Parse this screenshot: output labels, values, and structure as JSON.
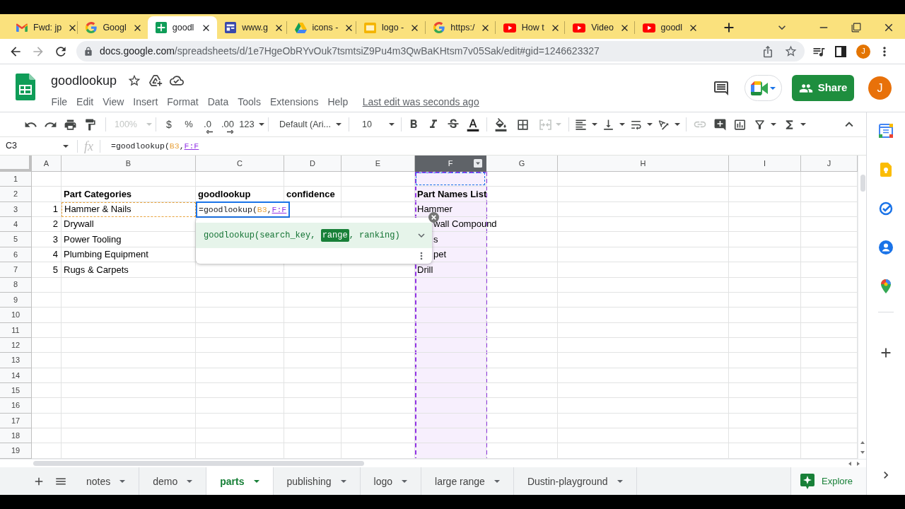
{
  "browser": {
    "tabs": [
      {
        "title": "Fwd: jp",
        "kind": "mail",
        "selected": false
      },
      {
        "title": "Googl",
        "kind": "g-logo",
        "selected": false
      },
      {
        "title": "goodl",
        "kind": "sheet",
        "selected": true
      },
      {
        "title": "www.g",
        "kind": "site",
        "selected": false
      },
      {
        "title": "icons -",
        "kind": "drive",
        "selected": false
      },
      {
        "title": "logo -",
        "kind": "slide",
        "selected": false
      },
      {
        "title": "https:/",
        "kind": "g-logo",
        "selected": false
      },
      {
        "title": "How t",
        "kind": "video",
        "selected": false
      },
      {
        "title": "Video",
        "kind": "video",
        "selected": false
      },
      {
        "title": "goodl",
        "kind": "video",
        "selected": false
      }
    ],
    "url": {
      "host": "docs.google.com",
      "path": "/spreadsheets/d/1e7HgeObRYvOuk7tsmtsiZ9Pu4m3QwBaKHtsm7v05Sak/edit#gid=1246623327"
    },
    "profile": "J"
  },
  "doc": {
    "title": "goodlookup",
    "menu": [
      "File",
      "Edit",
      "View",
      "Insert",
      "Format",
      "Data",
      "Tools",
      "Extensions",
      "Help"
    ],
    "last_edit": "Last edit was seconds ago",
    "share": "Share",
    "avatar": "J"
  },
  "toolbar": {
    "zoom": {
      "label": "100%",
      "disabled": true
    },
    "currency": "$",
    "percent": "%",
    "decimal_decrease": ".0",
    "decimal_increase": ".00",
    "number_format": "123",
    "font": "Default (Ari...",
    "font_size": "10",
    "merge": {
      "disabled": true
    },
    "link": {
      "disabled": true
    }
  },
  "formula_bar": {
    "name_box": "C3",
    "fx": "fx",
    "formula": [
      {
        "text": "=goodlookup(",
        "kind": "text",
        "active": false
      },
      {
        "text": "B3",
        "kind": "ref",
        "color": "#e8a33d",
        "active": false
      },
      {
        "text": ",",
        "kind": "text",
        "active": false
      },
      {
        "text": "F:F",
        "kind": "ref",
        "color": "#9334e6",
        "active": true
      }
    ]
  },
  "grid": {
    "columns": [
      {
        "label": "A",
        "selected": false
      },
      {
        "label": "B",
        "selected": false
      },
      {
        "label": "C",
        "selected": false
      },
      {
        "label": "D",
        "selected": false
      },
      {
        "label": "E",
        "selected": false
      },
      {
        "label": "F",
        "selected": true,
        "color": "#9334e6"
      },
      {
        "label": "G",
        "selected": false
      },
      {
        "label": "H",
        "selected": false
      },
      {
        "label": "I",
        "selected": false
      },
      {
        "label": "J",
        "selected": false
      }
    ],
    "rows": [
      {
        "label": "1"
      },
      {
        "label": "2",
        "cells": [
          null,
          {
            "text": "Part Categories",
            "kind": "text",
            "bold": true
          },
          {
            "text": "goodlookup",
            "kind": "text",
            "bold": true
          },
          {
            "text": "confidence",
            "kind": "text",
            "bold": true
          },
          null,
          {
            "text": "Part Names List",
            "kind": "text",
            "bold": true
          }
        ]
      },
      {
        "label": "3",
        "cells": [
          {
            "text": "1",
            "kind": "number",
            "bold": false
          },
          {
            "text": "Hammer & Nails",
            "kind": "text",
            "bold": false,
            "color": "#e8a33d"
          },
          {
            "kind": "editing",
            "formula": [
              {
                "text": "=goodlookup(",
                "kind": "text",
                "active": false
              },
              {
                "text": "B3",
                "kind": "ref",
                "color": "#e8a33d",
                "active": false
              },
              {
                "text": ",",
                "kind": "text",
                "active": false
              },
              {
                "text": "F:F",
                "kind": "ref",
                "color": "#9334e6",
                "active": true
              }
            ]
          },
          null,
          null,
          {
            "text": "Hammer",
            "kind": "text",
            "bold": false
          }
        ]
      },
      {
        "label": "4",
        "cells": [
          {
            "text": "2",
            "kind": "number",
            "bold": false
          },
          {
            "text": "Drywall",
            "kind": "text",
            "bold": false
          },
          null,
          null,
          null,
          {
            "text": "wall Compound",
            "kind": "text",
            "bold": false,
            "partly_covered": true
          }
        ]
      },
      {
        "label": "5",
        "cells": [
          {
            "text": "3",
            "kind": "number",
            "bold": false
          },
          {
            "text": "Power Tooling",
            "kind": "text",
            "bold": false
          },
          null,
          null,
          null,
          {
            "text": "s",
            "kind": "text",
            "bold": false,
            "partly_covered": true
          }
        ]
      },
      {
        "label": "6",
        "cells": [
          {
            "text": "4",
            "kind": "number",
            "bold": false
          },
          {
            "text": "Plumbing Equipment",
            "kind": "text",
            "bold": false
          },
          null,
          null,
          null,
          {
            "text": "pet",
            "kind": "text",
            "bold": false,
            "partly_covered": true
          }
        ]
      },
      {
        "label": "7",
        "cells": [
          {
            "text": "5",
            "kind": "number",
            "bold": false
          },
          {
            "text": "Rugs & Carpets",
            "kind": "text",
            "bold": false
          },
          null,
          null,
          null,
          {
            "text": "Drill",
            "kind": "text",
            "bold": false
          }
        ]
      },
      {
        "label": "8"
      },
      {
        "label": "9"
      },
      {
        "label": "10"
      },
      {
        "label": "11"
      },
      {
        "label": "12"
      },
      {
        "label": "13"
      },
      {
        "label": "14"
      },
      {
        "label": "15"
      },
      {
        "label": "16"
      },
      {
        "label": "17"
      },
      {
        "label": "18"
      },
      {
        "label": "19"
      }
    ]
  },
  "hint": {
    "signature": [
      {
        "text": "goodlookup(search_key, ",
        "current": false
      },
      {
        "text": "range",
        "current": true
      },
      {
        "text": ", ranking)",
        "current": false
      }
    ]
  },
  "sheet_tabs": {
    "tabs": [
      {
        "label": "notes",
        "selected": false
      },
      {
        "label": "demo",
        "selected": false
      },
      {
        "label": "parts",
        "selected": true
      },
      {
        "label": "publishing",
        "selected": false
      },
      {
        "label": "logo",
        "selected": false
      },
      {
        "label": "large range",
        "selected": false
      },
      {
        "label": "Dustin-playground",
        "selected": false
      }
    ],
    "explore": "Explore"
  }
}
